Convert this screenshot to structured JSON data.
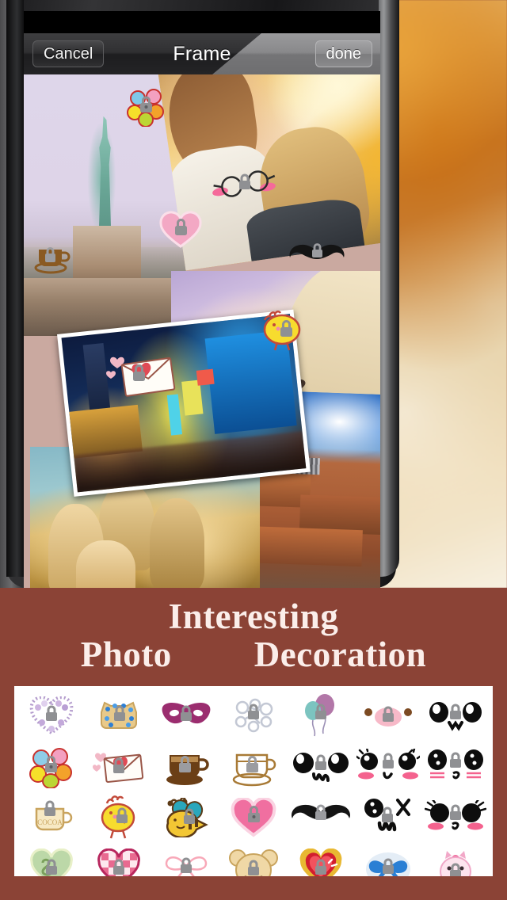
{
  "app": {
    "navbar": {
      "cancel_label": "Cancel",
      "title": "Frame",
      "done_label": "done"
    },
    "accent_brown": "#8b4336",
    "panel_white": "#ffffff"
  },
  "promo": {
    "line1": "Interesting",
    "line2_left": "Photo",
    "line2_right": "Decoration"
  },
  "collage": {
    "photos": [
      {
        "name": "statue-of-liberty-photo",
        "caption": "Statue of Liberty"
      },
      {
        "name": "two-girls-autumn-photo",
        "caption": "Two girls in autumn leaves"
      },
      {
        "name": "blonde-child-photo",
        "caption": "Blonde child lying down"
      },
      {
        "name": "night-city-street-photo",
        "caption": "Night city street with neon signs"
      },
      {
        "name": "favela-brick-houses-photo",
        "caption": "Brick houses under blue sky"
      },
      {
        "name": "friends-group-photo",
        "caption": "Group of friends looking down"
      }
    ],
    "applied_stickers": [
      {
        "name": "flower-sticker",
        "icon": "flower"
      },
      {
        "name": "coffee-cup-sticker",
        "icon": "coffee-cup"
      },
      {
        "name": "pink-heart-sticker",
        "icon": "pink-heart"
      },
      {
        "name": "glasses-blush-sticker",
        "icon": "glasses-blush"
      },
      {
        "name": "mustache-sticker",
        "icon": "mustache"
      },
      {
        "name": "chick-sticker",
        "icon": "chick"
      },
      {
        "name": "envelope-sticker",
        "icon": "envelope"
      }
    ]
  },
  "picker": {
    "locked_badge": "lock",
    "rows": [
      [
        {
          "name": "sticker-lavender-heart",
          "icon": "lavender-heart",
          "locked": true
        },
        {
          "name": "sticker-blue-jewel-dog",
          "icon": "jewel-dog",
          "locked": true
        },
        {
          "name": "sticker-purple-masquerade-mask",
          "icon": "mask",
          "locked": true
        },
        {
          "name": "sticker-crystal-key",
          "icon": "crystal-key",
          "locked": true
        },
        {
          "name": "sticker-balloons",
          "icon": "balloons",
          "locked": true
        },
        {
          "name": "sticker-pink-nose-face",
          "icon": "pink-nose",
          "locked": true
        },
        {
          "name": "sticker-black-eyes-w-mouth",
          "icon": "eyes-w",
          "locked": true
        }
      ],
      [
        {
          "name": "sticker-colorful-flower",
          "icon": "flower",
          "locked": true
        },
        {
          "name": "sticker-love-envelope",
          "icon": "envelope",
          "locked": true
        },
        {
          "name": "sticker-brown-coffee-cup",
          "icon": "coffee-cup-dark",
          "locked": true
        },
        {
          "name": "sticker-outline-coffee-cup",
          "icon": "coffee-cup-light",
          "locked": true
        },
        {
          "name": "sticker-eyes-omega-mouth",
          "icon": "eyes-omega",
          "locked": true
        },
        {
          "name": "sticker-lashes-blush-face",
          "icon": "lashes-blush",
          "locked": true
        },
        {
          "name": "sticker-blush-lines-face",
          "icon": "blush-lines",
          "locked": true
        }
      ],
      [
        {
          "name": "sticker-cocoa-mug",
          "icon": "cocoa-mug",
          "locked": true
        },
        {
          "name": "sticker-yellow-chick",
          "icon": "chick",
          "locked": true
        },
        {
          "name": "sticker-bumble-bee",
          "icon": "bee",
          "locked": true
        },
        {
          "name": "sticker-pink-heart",
          "icon": "pink-heart",
          "locked": true
        },
        {
          "name": "sticker-black-mustache",
          "icon": "mustache",
          "locked": true
        },
        {
          "name": "sticker-face-x-eye",
          "icon": "face-x",
          "locked": true
        },
        {
          "name": "sticker-lashes-face-blush",
          "icon": "lashes-face",
          "locked": true
        }
      ],
      [
        {
          "name": "sticker-green-swirl-heart",
          "icon": "swirl-heart",
          "locked": true
        },
        {
          "name": "sticker-checkered-heart",
          "icon": "checkered-heart",
          "locked": true
        },
        {
          "name": "sticker-pink-ribbon-bow",
          "icon": "ribbon-bow",
          "locked": true
        },
        {
          "name": "sticker-teddy-bear-face",
          "icon": "bear",
          "locked": true
        },
        {
          "name": "sticker-ruby-gold-heart",
          "icon": "ruby-heart",
          "locked": true
        },
        {
          "name": "sticker-blue-gem-bow",
          "icon": "blue-gem",
          "locked": true
        },
        {
          "name": "sticker-pink-cat-face",
          "icon": "pink-cat",
          "locked": true
        }
      ]
    ]
  }
}
